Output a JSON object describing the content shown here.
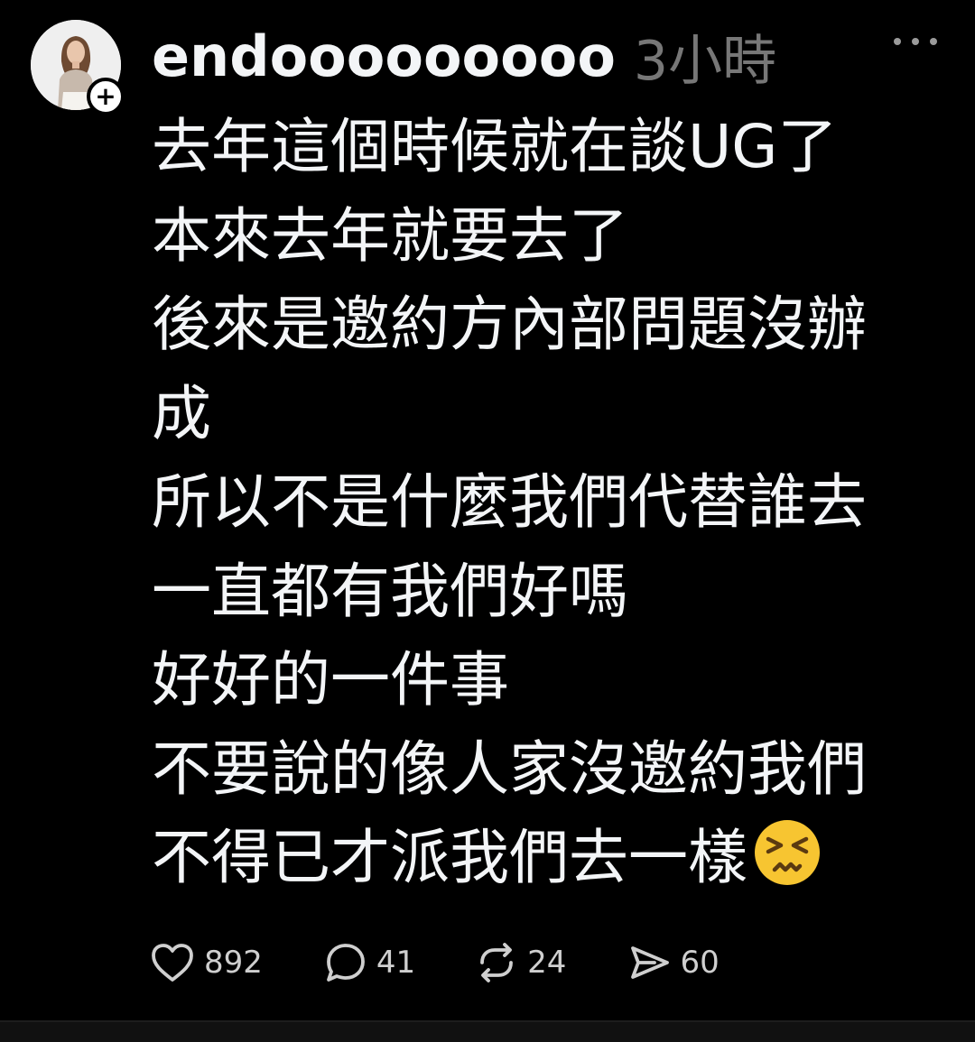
{
  "post": {
    "username": "endooooooooo",
    "time": "3小時",
    "lines": [
      "去年這個時候就在談UG了",
      "本來去年就要去了",
      "後來是邀約方內部問題沒辦",
      "成",
      "所以不是什麼我們代替誰去",
      "一直都有我們好嗎",
      "好好的一件事",
      "不要說的像人家沒邀約我們",
      "不得已才派我們去一樣"
    ],
    "emoji": "persevering-face-emoji"
  },
  "actions": {
    "likes": "892",
    "replies": "41",
    "reposts": "24",
    "shares": "60"
  },
  "icons": {
    "like": "heart-icon",
    "reply": "speech-bubble-icon",
    "repost": "repost-icon",
    "share": "send-icon",
    "more": "more-icon",
    "follow": "plus-icon"
  },
  "colors": {
    "background": "#000000",
    "text": "#f3f5f7",
    "secondary": "#777777",
    "emoji": "#f7c531"
  }
}
